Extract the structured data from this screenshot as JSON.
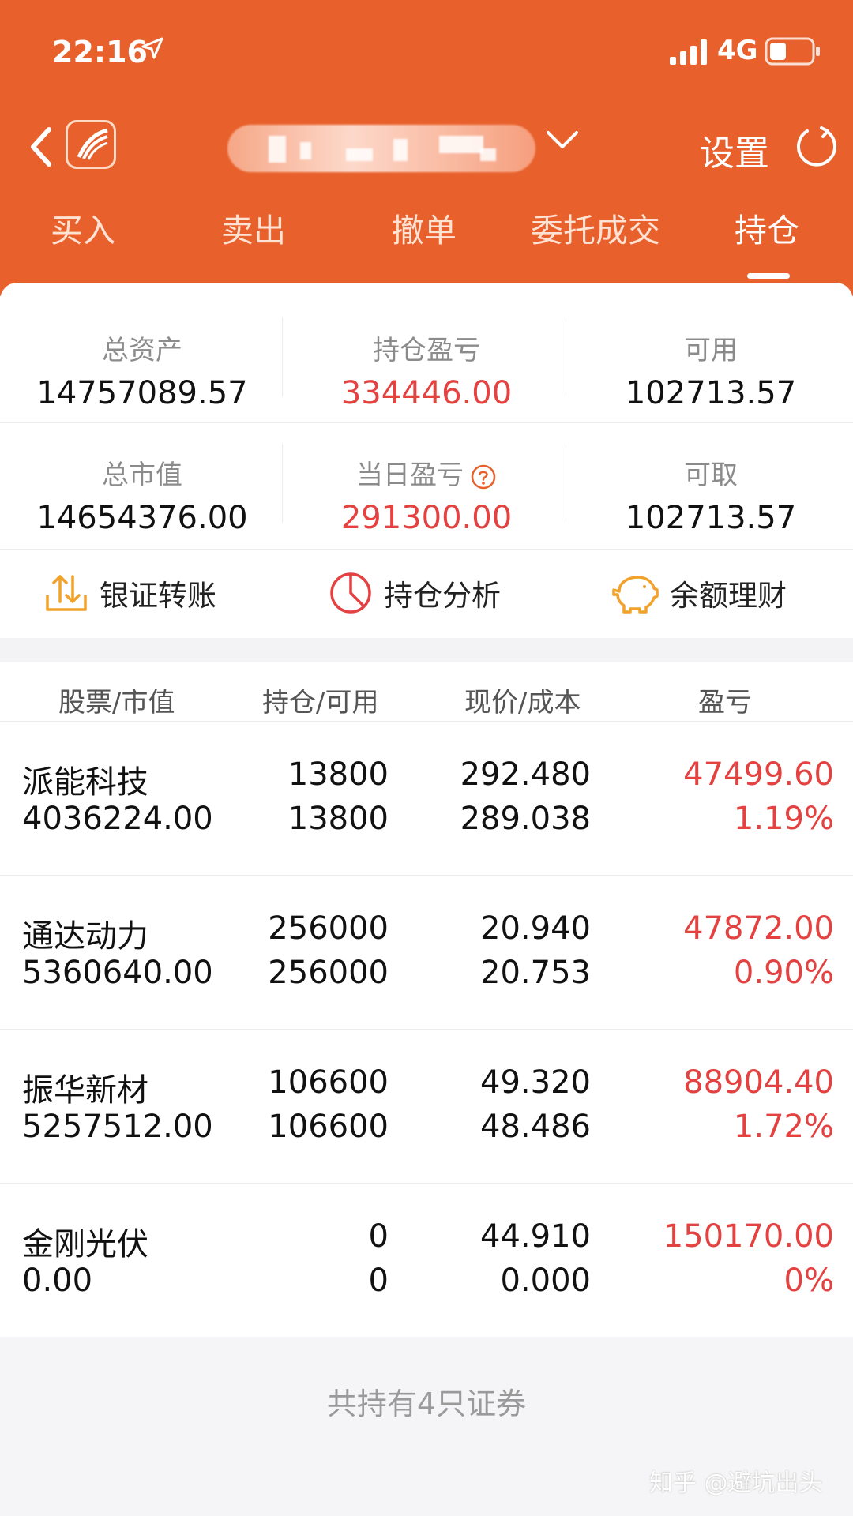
{
  "status_bar": {
    "time": "22:16",
    "network": "4G"
  },
  "header": {
    "settings_label": "设置"
  },
  "tabs": [
    {
      "label": "买入"
    },
    {
      "label": "卖出"
    },
    {
      "label": "撤单"
    },
    {
      "label": "委托成交"
    },
    {
      "label": "持仓",
      "active": true
    }
  ],
  "summary": {
    "total_assets": {
      "label": "总资产",
      "value": "14757089.57"
    },
    "position_pl": {
      "label": "持仓盈亏",
      "value": "334446.00"
    },
    "available": {
      "label": "可用",
      "value": "102713.57"
    },
    "market_value": {
      "label": "总市值",
      "value": "14654376.00"
    },
    "daily_pl": {
      "label": "当日盈亏",
      "value": "291300.00"
    },
    "withdrawable": {
      "label": "可取",
      "value": "102713.57"
    }
  },
  "actions": {
    "transfer": "银证转账",
    "analysis": "持仓分析",
    "wealth": "余额理财"
  },
  "table": {
    "headers": [
      "股票/市值",
      "持仓/可用",
      "现价/成本",
      "盈亏"
    ],
    "rows": [
      {
        "name": "派能科技",
        "market_value": "4036224.00",
        "holding": "13800",
        "available": "13800",
        "price": "292.480",
        "cost": "289.038",
        "pl": "47499.60",
        "pl_pct": "1.19%"
      },
      {
        "name": "通达动力",
        "market_value": "5360640.00",
        "holding": "256000",
        "available": "256000",
        "price": "20.940",
        "cost": "20.753",
        "pl": "47872.00",
        "pl_pct": "0.90%"
      },
      {
        "name": "振华新材",
        "market_value": "5257512.00",
        "holding": "106600",
        "available": "106600",
        "price": "49.320",
        "cost": "48.486",
        "pl": "88904.40",
        "pl_pct": "1.72%"
      },
      {
        "name": "金刚光伏",
        "market_value": "0.00",
        "holding": "0",
        "available": "0",
        "price": "44.910",
        "cost": "0.000",
        "pl": "150170.00",
        "pl_pct": "0%"
      }
    ]
  },
  "footer": {
    "text": "共持有4只证券",
    "watermark": "知乎 @避坑出头"
  },
  "colors": {
    "brand": "#e8612c",
    "loss_gain_red": "#e44141"
  }
}
